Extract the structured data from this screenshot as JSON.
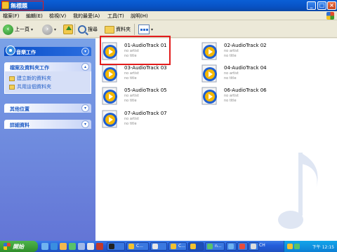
{
  "window": {
    "title": "無標題",
    "buttons": {
      "minimize": "_",
      "maximize": "□",
      "close": "×"
    }
  },
  "menubar": {
    "items": [
      "檔案(F)",
      "編輯(E)",
      "檢視(V)",
      "我的最愛(A)",
      "工具(T)",
      "說明(H)"
    ]
  },
  "toolbar": {
    "back_label": "上一頁",
    "search_label": "搜尋",
    "folders_label": "資料夾"
  },
  "taskpane": {
    "music_tasks": {
      "title": "音樂工作"
    },
    "file_tasks": {
      "title": "檔案及資料夾工作",
      "links": [
        "建立新的資料夾",
        "共用這個資料夾"
      ]
    },
    "other_places": {
      "title": "其他位置"
    },
    "details": {
      "title": "詳細資料"
    }
  },
  "files": [
    {
      "name": "01-AudioTrack 01",
      "artist": "no artist",
      "title": "no title"
    },
    {
      "name": "02-AudioTrack 02",
      "artist": "no artist",
      "title": "no title"
    },
    {
      "name": "03-AudioTrack 03",
      "artist": "no artist",
      "title": "no title"
    },
    {
      "name": "04-AudioTrack 04",
      "artist": "no artist",
      "title": "no title"
    },
    {
      "name": "05-AudioTrack 05",
      "artist": "no artist",
      "title": "no title"
    },
    {
      "name": "06-AudioTrack 06",
      "artist": "no artist",
      "title": "no title"
    },
    {
      "name": "07-AudioTrack 07",
      "artist": "no artist",
      "title": "no title"
    }
  ],
  "taskbar": {
    "start_label": "開始",
    "task_buttons": [
      "",
      "C...",
      "",
      "C...",
      "",
      "n...",
      "",
      "",
      ""
    ],
    "language": "CH",
    "clock": "下午 12:15"
  }
}
